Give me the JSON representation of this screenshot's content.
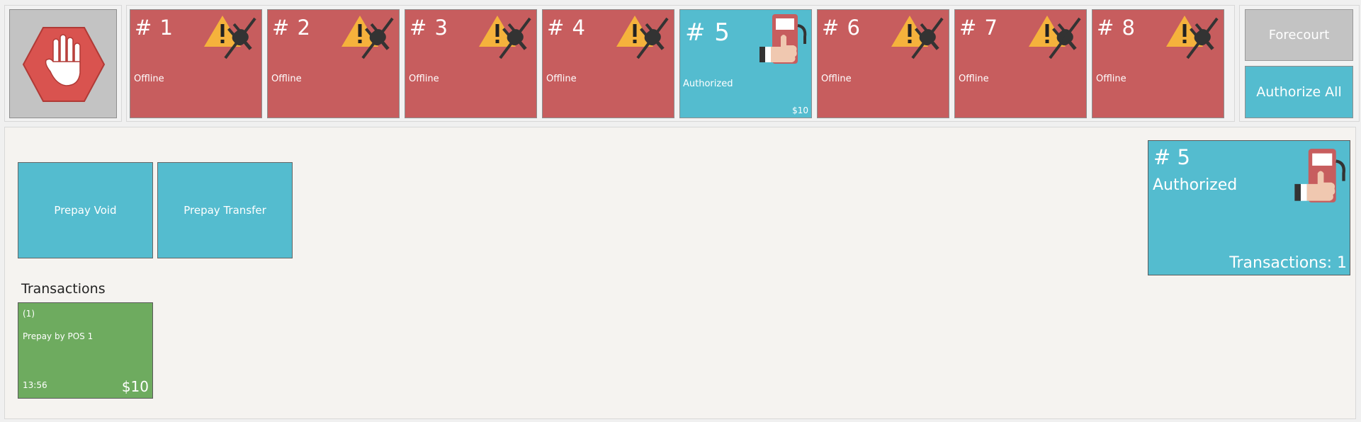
{
  "stop": {
    "icon": "stop-hand-icon"
  },
  "pumps": [
    {
      "number": "# 1",
      "status": "Offline",
      "amount": "",
      "state": "offline",
      "icon": "offline-warning-plug-icon"
    },
    {
      "number": "# 2",
      "status": "Offline",
      "amount": "",
      "state": "offline",
      "icon": "offline-warning-plug-icon"
    },
    {
      "number": "# 3",
      "status": "Offline",
      "amount": "",
      "state": "offline",
      "icon": "offline-warning-plug-icon"
    },
    {
      "number": "# 4",
      "status": "Offline",
      "amount": "",
      "state": "offline",
      "icon": "offline-warning-plug-icon"
    },
    {
      "number": "# 5",
      "status": "Authorized",
      "amount": "$10",
      "state": "authorized",
      "icon": "fuel-pump-thumbs-up-icon"
    },
    {
      "number": "# 6",
      "status": "Offline",
      "amount": "",
      "state": "offline",
      "icon": "offline-warning-plug-icon"
    },
    {
      "number": "# 7",
      "status": "Offline",
      "amount": "",
      "state": "offline",
      "icon": "offline-warning-plug-icon"
    },
    {
      "number": "# 8",
      "status": "Offline",
      "amount": "",
      "state": "offline",
      "icon": "offline-warning-plug-icon"
    }
  ],
  "right_buttons": {
    "forecourt": "Forecourt",
    "authorize_all": "Authorize All"
  },
  "actions": {
    "prepay_void": "Prepay Void",
    "prepay_transfer": "Prepay Transfer"
  },
  "transactions": {
    "title": "Transactions",
    "items": [
      {
        "id": "(1)",
        "description": "Prepay by POS 1",
        "time": "13:56",
        "amount": "$10"
      }
    ]
  },
  "selected_pump": {
    "number": "# 5",
    "status": "Authorized",
    "transactions": "Transactions: 1",
    "icon": "fuel-pump-thumbs-up-icon"
  },
  "colors": {
    "offline": "#c75d5e",
    "authorized": "#54bccf",
    "transaction": "#6eab5f",
    "disabled": "#c3c3c3"
  }
}
